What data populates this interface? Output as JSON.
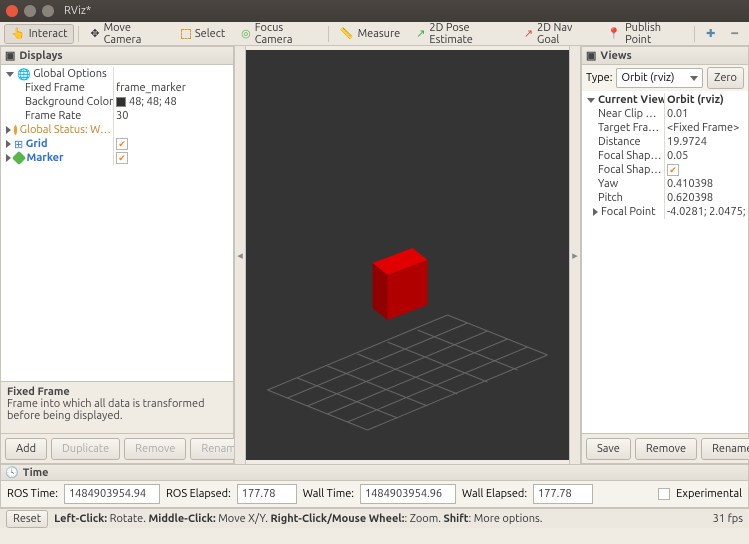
{
  "window": {
    "title": "RViz*"
  },
  "toolbar": {
    "interact": "Interact",
    "move_camera": "Move Camera",
    "select": "Select",
    "focus_camera": "Focus Camera",
    "measure": "Measure",
    "pose_estimate": "2D Pose Estimate",
    "nav_goal": "2D Nav Goal",
    "publish_point": "Publish Point"
  },
  "displays": {
    "title": "Displays",
    "global_options": "Global Options",
    "fixed_frame_label": "Fixed Frame",
    "fixed_frame_value": "frame_marker",
    "bg_color_label": "Background Color",
    "bg_color_value": "48; 48; 48",
    "frame_rate_label": "Frame Rate",
    "frame_rate_value": "30",
    "global_status": "Global Status: W…",
    "grid": "Grid",
    "marker": "Marker",
    "desc_title": "Fixed Frame",
    "desc_body": "Frame into which all data is transformed before being displayed.",
    "add": "Add",
    "duplicate": "Duplicate",
    "remove": "Remove",
    "rename": "Rename"
  },
  "views": {
    "title": "Views",
    "type_label": "Type:",
    "type_value": "Orbit (rviz)",
    "zero": "Zero",
    "current_view": "Current View",
    "current_view_val": "Orbit (rviz)",
    "props": [
      {
        "label": "Near Clip …",
        "value": "0.01"
      },
      {
        "label": "Target Fra…",
        "value": "<Fixed Frame>"
      },
      {
        "label": "Distance",
        "value": "19.9724"
      },
      {
        "label": "Focal Shap…",
        "value": "0.05"
      },
      {
        "label": "Focal Shap…",
        "value": "CHECK"
      },
      {
        "label": "Yaw",
        "value": "0.410398"
      },
      {
        "label": "Pitch",
        "value": "0.620398"
      },
      {
        "label": "Focal Point",
        "value": "-4.0281; 2.0475; …"
      }
    ],
    "save": "Save",
    "remove": "Remove",
    "rename": "Rename"
  },
  "time": {
    "title": "Time",
    "ros_time_label": "ROS Time:",
    "ros_time_value": "1484903954.94",
    "ros_elapsed_label": "ROS Elapsed:",
    "ros_elapsed_value": "177.78",
    "wall_time_label": "Wall Time:",
    "wall_time_value": "1484903954.96",
    "wall_elapsed_label": "Wall Elapsed:",
    "wall_elapsed_value": "177.78",
    "experimental": "Experimental"
  },
  "status": {
    "reset": "Reset",
    "hint_prefix": "Left-Click:",
    "hint_rotate": " Rotate. ",
    "hint_mc": "Middle-Click:",
    "hint_move": " Move X/Y. ",
    "hint_rc": "Right-Click/Mouse Wheel:",
    "hint_zoom": ": Zoom. ",
    "hint_shift": "Shift",
    "hint_more": ": More options.",
    "fps": "31 fps"
  },
  "colors": {
    "accent": "#f58220",
    "cube": "#d40000"
  }
}
